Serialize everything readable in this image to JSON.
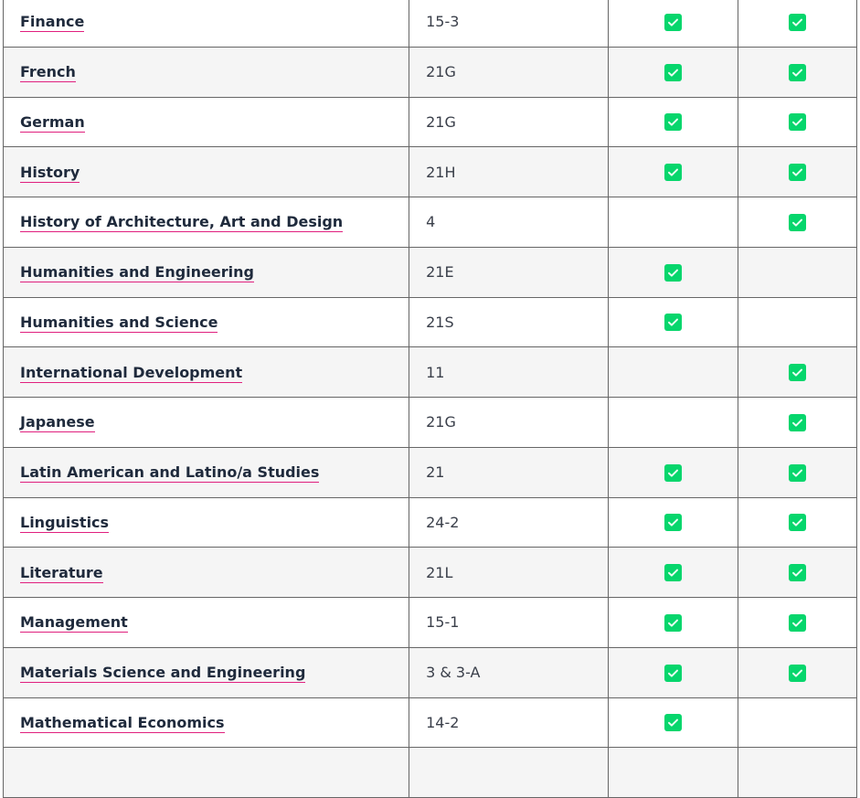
{
  "check_color": "#06d66c",
  "rows": [
    {
      "name": "Finance",
      "code": "15-3",
      "col1": true,
      "col2": true
    },
    {
      "name": "French",
      "code": "21G",
      "col1": true,
      "col2": true
    },
    {
      "name": "German",
      "code": "21G",
      "col1": true,
      "col2": true
    },
    {
      "name": "History",
      "code": "21H",
      "col1": true,
      "col2": true
    },
    {
      "name": "History of Architecture, Art and Design",
      "code": "4",
      "col1": false,
      "col2": true
    },
    {
      "name": "Humanities and Engineering",
      "code": "21E",
      "col1": true,
      "col2": false
    },
    {
      "name": "Humanities and Science",
      "code": "21S",
      "col1": true,
      "col2": false
    },
    {
      "name": "International Development",
      "code": "11",
      "col1": false,
      "col2": true
    },
    {
      "name": "Japanese",
      "code": "21G",
      "col1": false,
      "col2": true
    },
    {
      "name": "Latin American and Latino/a Studies",
      "code": "21",
      "col1": true,
      "col2": true
    },
    {
      "name": "Linguistics",
      "code": "24-2",
      "col1": true,
      "col2": true
    },
    {
      "name": "Literature",
      "code": "21L",
      "col1": true,
      "col2": true
    },
    {
      "name": "Management",
      "code": "15-1",
      "col1": true,
      "col2": true
    },
    {
      "name": "Materials Science and Engineering",
      "code": "3 & 3-A",
      "col1": true,
      "col2": true
    },
    {
      "name": "Mathematical Economics",
      "code": "14-2",
      "col1": true,
      "col2": false
    },
    {
      "name": "",
      "code": "",
      "col1": false,
      "col2": false
    }
  ]
}
